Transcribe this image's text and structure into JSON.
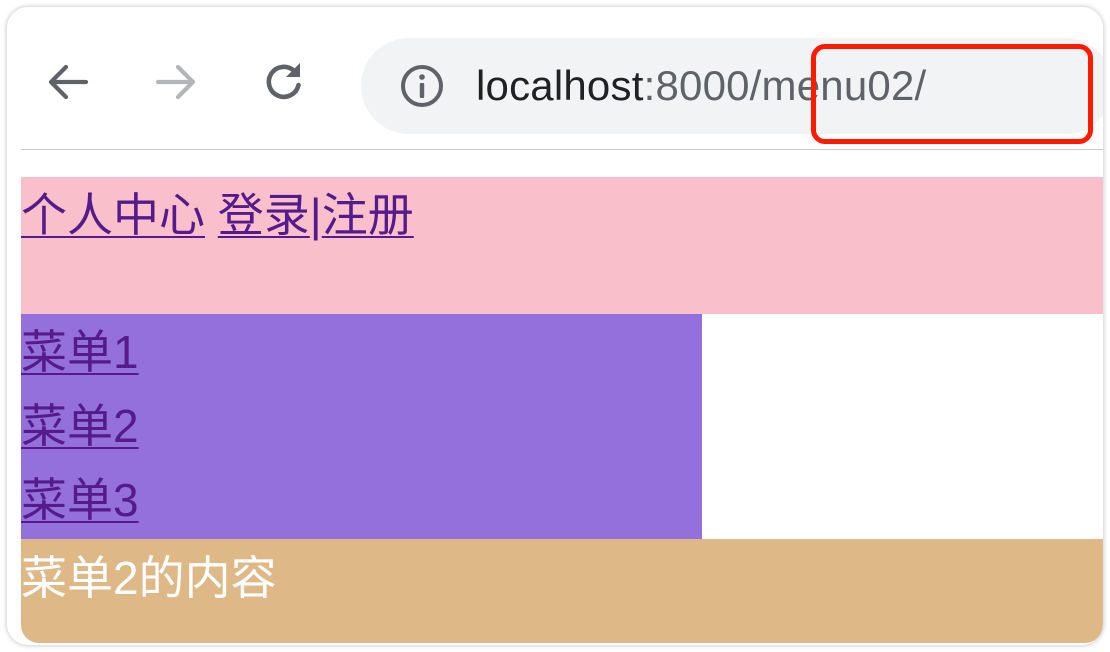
{
  "browser": {
    "url_host": "localhost",
    "url_rest": ":8000/menu02/"
  },
  "header": {
    "links": [
      "个人中心",
      "登录",
      "注册"
    ],
    "separator": "|",
    "background": "#f9c0cb"
  },
  "menu": {
    "items": [
      "菜单1",
      "菜单2",
      "菜单3"
    ],
    "background": "#9370db"
  },
  "content": {
    "text": "菜单2的内容",
    "background": "#deb887"
  },
  "annotation": {
    "highlight_color": "#ff1a00"
  },
  "colors": {
    "link": "#551a8b"
  }
}
